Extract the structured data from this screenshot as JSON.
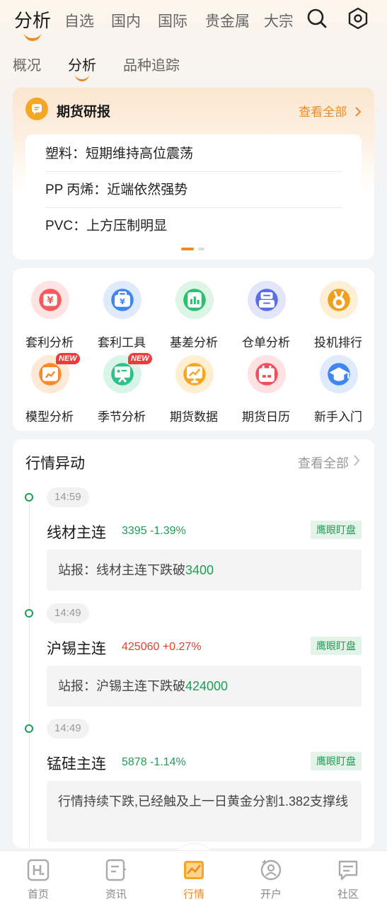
{
  "top_tabs": [
    "分析",
    "自选",
    "国内",
    "国际",
    "贵金属",
    "大宗"
  ],
  "sub_tabs": [
    "概况",
    "分析",
    "品种追踪"
  ],
  "report": {
    "title": "期货研报",
    "more": "查看全部",
    "items": [
      "塑料：短期维持高位震荡",
      "PP 丙烯：近端依然强势",
      "PVC：上方压制明显"
    ]
  },
  "tools": [
    {
      "label": "套利分析",
      "icon": "arbitrage-analysis-icon",
      "color": "#f25c5c",
      "bg": "#fde3e3",
      "badge": ""
    },
    {
      "label": "套利工具",
      "icon": "arbitrage-tool-icon",
      "color": "#3f86f0",
      "bg": "#dfeafd",
      "badge": ""
    },
    {
      "label": "基差分析",
      "icon": "basis-analysis-icon",
      "color": "#2fbf71",
      "bg": "#dcf5e7",
      "badge": ""
    },
    {
      "label": "仓单分析",
      "icon": "warehouse-receipt-icon",
      "color": "#5b6ee8",
      "bg": "#e3e6fb",
      "badge": ""
    },
    {
      "label": "投机排行",
      "icon": "medal-icon",
      "color": "#f0a020",
      "bg": "#fdefd6",
      "badge": ""
    },
    {
      "label": "模型分析",
      "icon": "model-analysis-icon",
      "color": "#f58a2e",
      "bg": "#fde9d6",
      "badge": "NEW"
    },
    {
      "label": "季节分析",
      "icon": "seasonal-analysis-icon",
      "color": "#2fbf88",
      "bg": "#d9f5ea",
      "badge": "NEW"
    },
    {
      "label": "期货数据",
      "icon": "futures-data-icon",
      "color": "#f5a623",
      "bg": "#fdefcf",
      "badge": ""
    },
    {
      "label": "期货日历",
      "icon": "calendar-icon",
      "color": "#f04e5a",
      "bg": "#fde1e3",
      "badge": ""
    },
    {
      "label": "新手入门",
      "icon": "graduation-cap-icon",
      "color": "#3f86f0",
      "bg": "#dfeafd",
      "badge": ""
    }
  ],
  "market": {
    "title": "行情异动",
    "more": "查看全部",
    "events": [
      {
        "time": "14:59",
        "name": "线材主连",
        "price": "3395 -1.39%",
        "direction": "down",
        "tag": "鹰眼盯盘",
        "text": "站报：线材主连下跌破",
        "highlight": "3400"
      },
      {
        "time": "14:49",
        "name": "沪锡主连",
        "price": "425060 +0.27%",
        "direction": "up",
        "tag": "鹰眼盯盘",
        "text": "站报：沪锡主连下跌破",
        "highlight": "424000"
      },
      {
        "time": "14:49",
        "name": "锰硅主连",
        "price": "5878 -1.14%",
        "direction": "down",
        "tag": "鹰眼盯盘",
        "text": "行情持续下跌,已经触及上一日黄金分割1.382支撑线",
        "highlight": ""
      }
    ]
  },
  "bottom_nav": [
    "首页",
    "资讯",
    "行情",
    "开户",
    "社区"
  ],
  "colors": {
    "accent": "#ef8a2b",
    "down": "#1f9d55",
    "up": "#d9472b"
  }
}
